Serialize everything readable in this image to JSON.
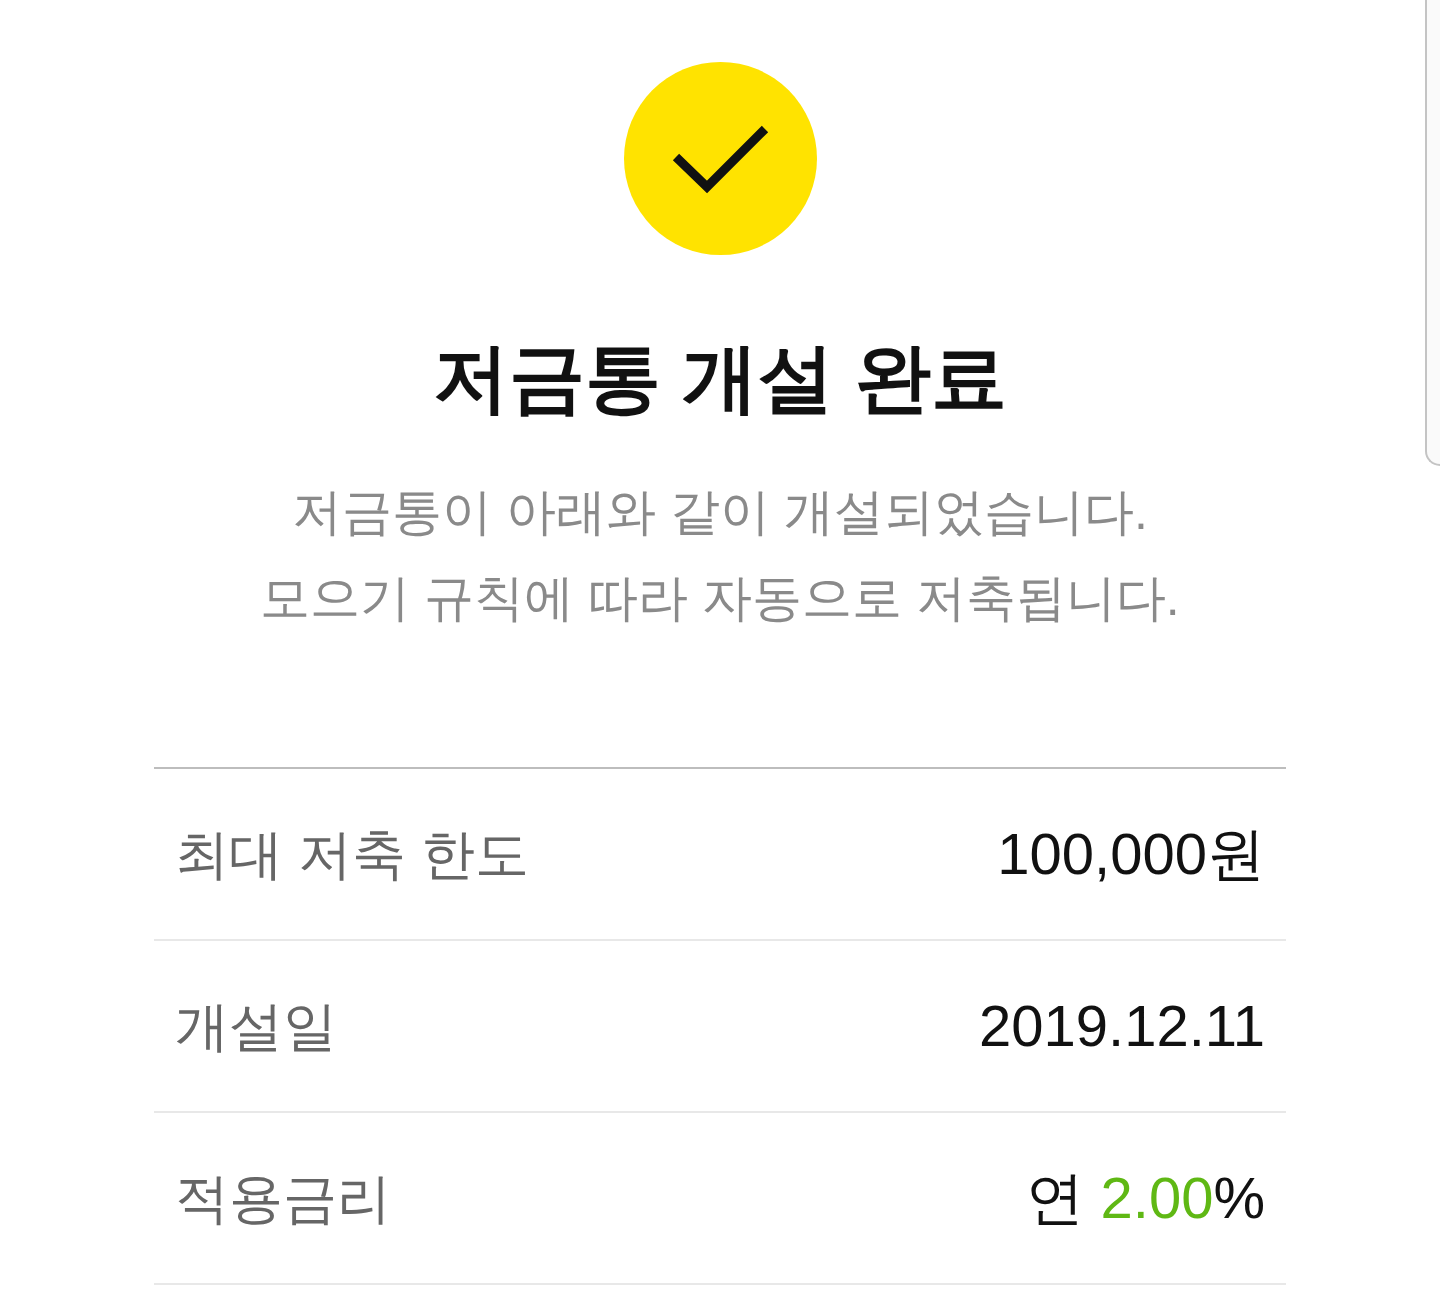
{
  "title": "저금통 개설 완료",
  "message_lines": [
    "저금통이 아래와 같이 개설되었습니다.",
    "모으기 규칙에 따라 자동으로 저축됩니다."
  ],
  "details": [
    {
      "label": "최대 저축 한도",
      "value": "100,000원"
    },
    {
      "label": "개설일",
      "value": "2019.12.11"
    },
    {
      "label": "적용금리",
      "value_parts": [
        {
          "text": "연 ",
          "highlight": false
        },
        {
          "text": "2.00",
          "highlight": true
        },
        {
          "text": "%",
          "highlight": false
        }
      ]
    }
  ]
}
